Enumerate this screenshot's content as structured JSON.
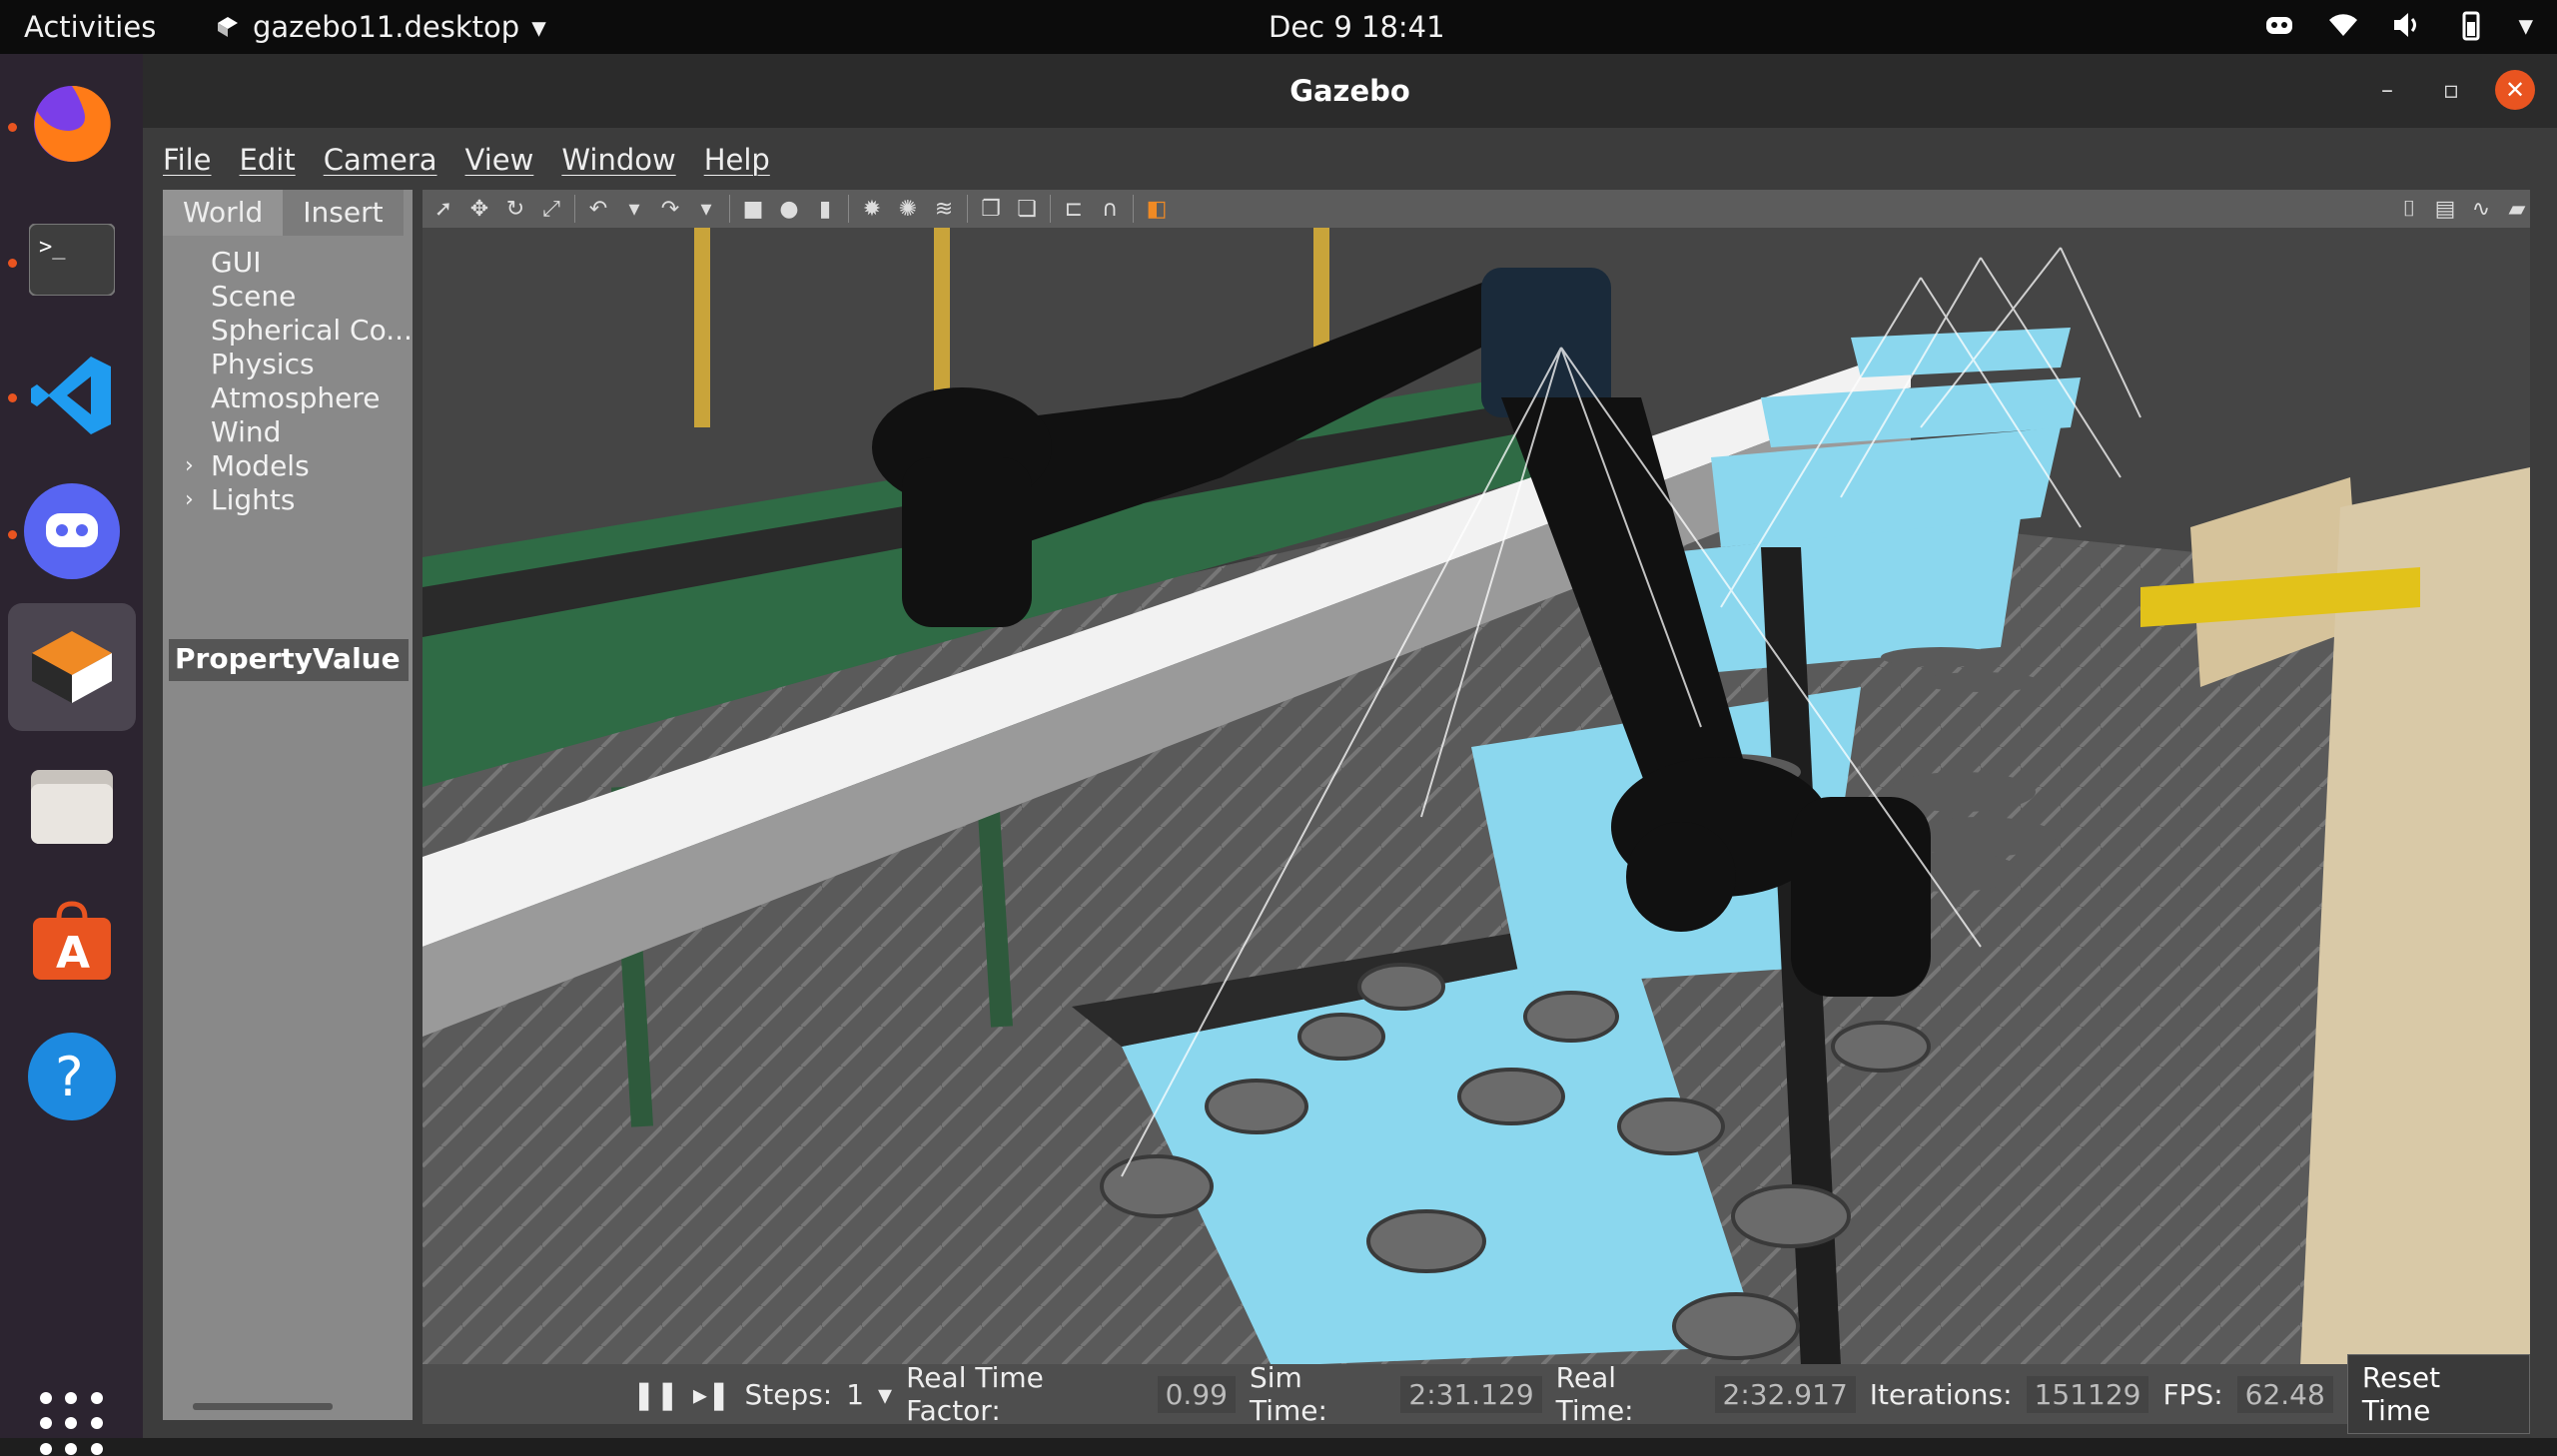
{
  "topbar": {
    "activities": "Activities",
    "app_name": "gazebo11.desktop",
    "clock": "Dec 9  18:41"
  },
  "dock": {
    "items": [
      "firefox-icon",
      "terminal-icon",
      "vscode-icon",
      "discord-icon",
      "gazebo-icon",
      "files-icon",
      "app-center-icon",
      "help-icon"
    ]
  },
  "window": {
    "title": "Gazebo"
  },
  "menubar": {
    "items": [
      "File",
      "Edit",
      "Camera",
      "View",
      "Window",
      "Help"
    ]
  },
  "leftpanel": {
    "tabs": [
      "World",
      "Insert"
    ],
    "tree": [
      "GUI",
      "Scene",
      "Spherical Co...",
      "Physics",
      "Atmosphere",
      "Wind",
      "Models",
      "Lights"
    ],
    "property_header": "PropertyValue"
  },
  "statusbar": {
    "steps_label": "Steps:",
    "steps_value": "1",
    "rtf_label": "Real Time Factor:",
    "rtf_value": "0.99",
    "sim_time_label": "Sim Time:",
    "sim_time_value": "2:31.129",
    "real_time_label": "Real Time:",
    "real_time_value": "2:32.917",
    "iterations_label": "Iterations:",
    "iterations_value": "151129",
    "fps_label": "FPS:",
    "fps_value": "62.48",
    "reset_label": "Reset Time"
  },
  "colors": {
    "bin_floor": "#7fd8f2",
    "accent_close": "#e95420"
  }
}
